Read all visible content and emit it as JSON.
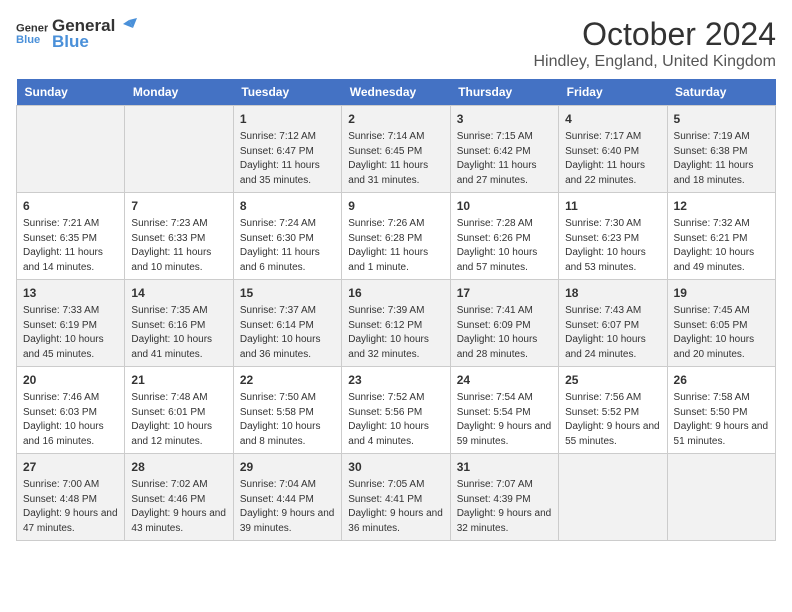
{
  "header": {
    "logo_line1": "General",
    "logo_line2": "Blue",
    "month": "October 2024",
    "location": "Hindley, England, United Kingdom"
  },
  "weekdays": [
    "Sunday",
    "Monday",
    "Tuesday",
    "Wednesday",
    "Thursday",
    "Friday",
    "Saturday"
  ],
  "weeks": [
    [
      {
        "num": "",
        "info": ""
      },
      {
        "num": "",
        "info": ""
      },
      {
        "num": "1",
        "info": "Sunrise: 7:12 AM\nSunset: 6:47 PM\nDaylight: 11 hours and 35 minutes."
      },
      {
        "num": "2",
        "info": "Sunrise: 7:14 AM\nSunset: 6:45 PM\nDaylight: 11 hours and 31 minutes."
      },
      {
        "num": "3",
        "info": "Sunrise: 7:15 AM\nSunset: 6:42 PM\nDaylight: 11 hours and 27 minutes."
      },
      {
        "num": "4",
        "info": "Sunrise: 7:17 AM\nSunset: 6:40 PM\nDaylight: 11 hours and 22 minutes."
      },
      {
        "num": "5",
        "info": "Sunrise: 7:19 AM\nSunset: 6:38 PM\nDaylight: 11 hours and 18 minutes."
      }
    ],
    [
      {
        "num": "6",
        "info": "Sunrise: 7:21 AM\nSunset: 6:35 PM\nDaylight: 11 hours and 14 minutes."
      },
      {
        "num": "7",
        "info": "Sunrise: 7:23 AM\nSunset: 6:33 PM\nDaylight: 11 hours and 10 minutes."
      },
      {
        "num": "8",
        "info": "Sunrise: 7:24 AM\nSunset: 6:30 PM\nDaylight: 11 hours and 6 minutes."
      },
      {
        "num": "9",
        "info": "Sunrise: 7:26 AM\nSunset: 6:28 PM\nDaylight: 11 hours and 1 minute."
      },
      {
        "num": "10",
        "info": "Sunrise: 7:28 AM\nSunset: 6:26 PM\nDaylight: 10 hours and 57 minutes."
      },
      {
        "num": "11",
        "info": "Sunrise: 7:30 AM\nSunset: 6:23 PM\nDaylight: 10 hours and 53 minutes."
      },
      {
        "num": "12",
        "info": "Sunrise: 7:32 AM\nSunset: 6:21 PM\nDaylight: 10 hours and 49 minutes."
      }
    ],
    [
      {
        "num": "13",
        "info": "Sunrise: 7:33 AM\nSunset: 6:19 PM\nDaylight: 10 hours and 45 minutes."
      },
      {
        "num": "14",
        "info": "Sunrise: 7:35 AM\nSunset: 6:16 PM\nDaylight: 10 hours and 41 minutes."
      },
      {
        "num": "15",
        "info": "Sunrise: 7:37 AM\nSunset: 6:14 PM\nDaylight: 10 hours and 36 minutes."
      },
      {
        "num": "16",
        "info": "Sunrise: 7:39 AM\nSunset: 6:12 PM\nDaylight: 10 hours and 32 minutes."
      },
      {
        "num": "17",
        "info": "Sunrise: 7:41 AM\nSunset: 6:09 PM\nDaylight: 10 hours and 28 minutes."
      },
      {
        "num": "18",
        "info": "Sunrise: 7:43 AM\nSunset: 6:07 PM\nDaylight: 10 hours and 24 minutes."
      },
      {
        "num": "19",
        "info": "Sunrise: 7:45 AM\nSunset: 6:05 PM\nDaylight: 10 hours and 20 minutes."
      }
    ],
    [
      {
        "num": "20",
        "info": "Sunrise: 7:46 AM\nSunset: 6:03 PM\nDaylight: 10 hours and 16 minutes."
      },
      {
        "num": "21",
        "info": "Sunrise: 7:48 AM\nSunset: 6:01 PM\nDaylight: 10 hours and 12 minutes."
      },
      {
        "num": "22",
        "info": "Sunrise: 7:50 AM\nSunset: 5:58 PM\nDaylight: 10 hours and 8 minutes."
      },
      {
        "num": "23",
        "info": "Sunrise: 7:52 AM\nSunset: 5:56 PM\nDaylight: 10 hours and 4 minutes."
      },
      {
        "num": "24",
        "info": "Sunrise: 7:54 AM\nSunset: 5:54 PM\nDaylight: 9 hours and 59 minutes."
      },
      {
        "num": "25",
        "info": "Sunrise: 7:56 AM\nSunset: 5:52 PM\nDaylight: 9 hours and 55 minutes."
      },
      {
        "num": "26",
        "info": "Sunrise: 7:58 AM\nSunset: 5:50 PM\nDaylight: 9 hours and 51 minutes."
      }
    ],
    [
      {
        "num": "27",
        "info": "Sunrise: 7:00 AM\nSunset: 4:48 PM\nDaylight: 9 hours and 47 minutes."
      },
      {
        "num": "28",
        "info": "Sunrise: 7:02 AM\nSunset: 4:46 PM\nDaylight: 9 hours and 43 minutes."
      },
      {
        "num": "29",
        "info": "Sunrise: 7:04 AM\nSunset: 4:44 PM\nDaylight: 9 hours and 39 minutes."
      },
      {
        "num": "30",
        "info": "Sunrise: 7:05 AM\nSunset: 4:41 PM\nDaylight: 9 hours and 36 minutes."
      },
      {
        "num": "31",
        "info": "Sunrise: 7:07 AM\nSunset: 4:39 PM\nDaylight: 9 hours and 32 minutes."
      },
      {
        "num": "",
        "info": ""
      },
      {
        "num": "",
        "info": ""
      }
    ]
  ]
}
